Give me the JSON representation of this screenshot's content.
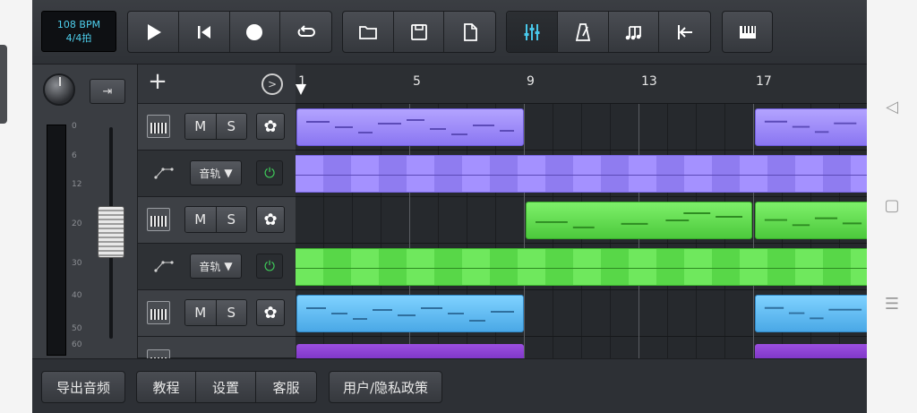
{
  "transport": {
    "tempo": "108 BPM",
    "time_signature": "4/4拍"
  },
  "toolbar": {
    "play_icon": "play-icon",
    "rewind_icon": "skip-back-icon",
    "record_icon": "record-icon",
    "loop_icon": "loop-icon",
    "open_icon": "folder-icon",
    "save_icon": "save-icon",
    "new_icon": "new-file-icon",
    "mixer_icon": "mixer-sliders-icon",
    "metronome_icon": "metronome-icon",
    "notes_icon": "music-notes-icon",
    "return_icon": "return-to-start-icon",
    "piano_icon": "piano-icon",
    "mixer_active": true
  },
  "mixer": {
    "arrow_icon": "arrow-right-icon",
    "db_labels": [
      "0",
      "6",
      "12",
      "20",
      "30",
      "40",
      "50",
      "60"
    ]
  },
  "ruler": {
    "bars": [
      "1",
      "5",
      "9",
      "13",
      "17"
    ]
  },
  "tracks": [
    {
      "type": "instrument",
      "mute": "M",
      "solo": "S",
      "color": "#9b88ff"
    },
    {
      "type": "automation",
      "target": "音轨",
      "color": "#9b88ff"
    },
    {
      "type": "instrument",
      "mute": "M",
      "solo": "S",
      "color": "#5fdc4c"
    },
    {
      "type": "automation",
      "target": "音轨",
      "color": "#5fdc4c"
    },
    {
      "type": "instrument",
      "mute": "M",
      "solo": "S",
      "color": "#5ab8f0"
    }
  ],
  "bottom": {
    "export": "导出音频",
    "tutorial": "教程",
    "settings": "设置",
    "support": "客服",
    "privacy": "用户/隐私政策"
  },
  "nav": {
    "back_icon": "back-triangle-icon",
    "home_icon": "home-square-icon",
    "menu_icon": "menu-lines-icon"
  }
}
